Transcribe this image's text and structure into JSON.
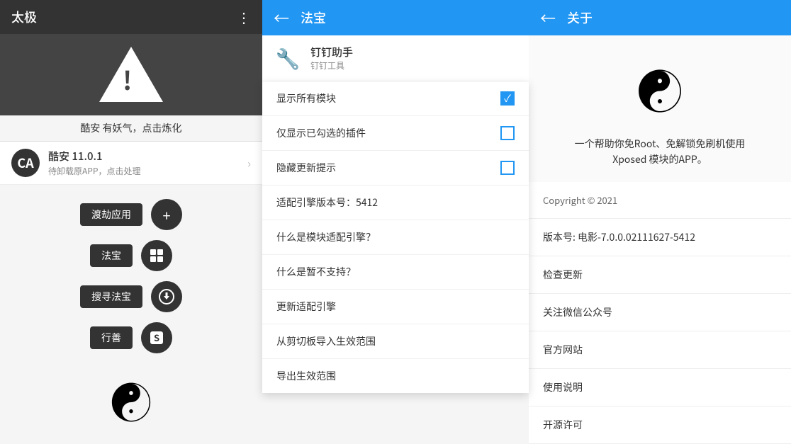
{
  "left": {
    "header": {
      "title": "太极",
      "dots": "⋮"
    },
    "warning_text": "酷安 有妖气，点击炼化",
    "app": {
      "icon": "CA",
      "name": "酷安 11.0.1",
      "sub": "待卸载原APP，点击处理"
    },
    "buttons": [
      {
        "label": "渡劫应用",
        "icon": "+"
      },
      {
        "label": "法宝",
        "icon": "⊞"
      },
      {
        "label": "搜寻法宝",
        "icon": "⬇"
      },
      {
        "label": "行善",
        "icon": "S"
      }
    ]
  },
  "middle": {
    "header": {
      "back": "←",
      "title": "法宝"
    },
    "plugin": {
      "name": "钉钉助手",
      "sub": "钉钉工具"
    },
    "menu": [
      {
        "id": "show_all",
        "text": "显示所有模块",
        "checkbox": "checked"
      },
      {
        "id": "show_checked",
        "text": "仅显示已勾选的插件",
        "checkbox": "empty"
      },
      {
        "id": "hide_updates",
        "text": "隐藏更新提示",
        "checkbox": "empty"
      },
      {
        "id": "adapter_version",
        "text": "适配引擎版本号：5412",
        "checkbox": "none"
      },
      {
        "id": "what_adapter",
        "text": "什么是模块适配引擎？",
        "checkbox": "none"
      },
      {
        "id": "what_unsupported",
        "text": "什么是暂不支持？",
        "checkbox": "none"
      },
      {
        "id": "update_adapter",
        "text": "更新适配引擎",
        "checkbox": "none"
      },
      {
        "id": "import_clipboard",
        "text": "从剪切板导入生效范围",
        "checkbox": "none"
      },
      {
        "id": "export_scope",
        "text": "导出生效范围",
        "checkbox": "none"
      }
    ]
  },
  "right": {
    "header": {
      "back": "←",
      "title": "关于"
    },
    "logo": "☯",
    "description": "一个帮助你免Root、免解锁免刷机使用\nXposed 模块的APP。",
    "items": [
      {
        "id": "copyright",
        "text": "Copyright © 2021"
      },
      {
        "id": "version",
        "text": "版本号: 电影-7.0.0.02111627-5412"
      },
      {
        "id": "check_update",
        "text": "检查更新"
      },
      {
        "id": "wechat",
        "text": "关注微信公众号"
      },
      {
        "id": "website",
        "text": "官方网站"
      },
      {
        "id": "manual",
        "text": "使用说明"
      },
      {
        "id": "open_source",
        "text": "开源许可"
      }
    ]
  }
}
